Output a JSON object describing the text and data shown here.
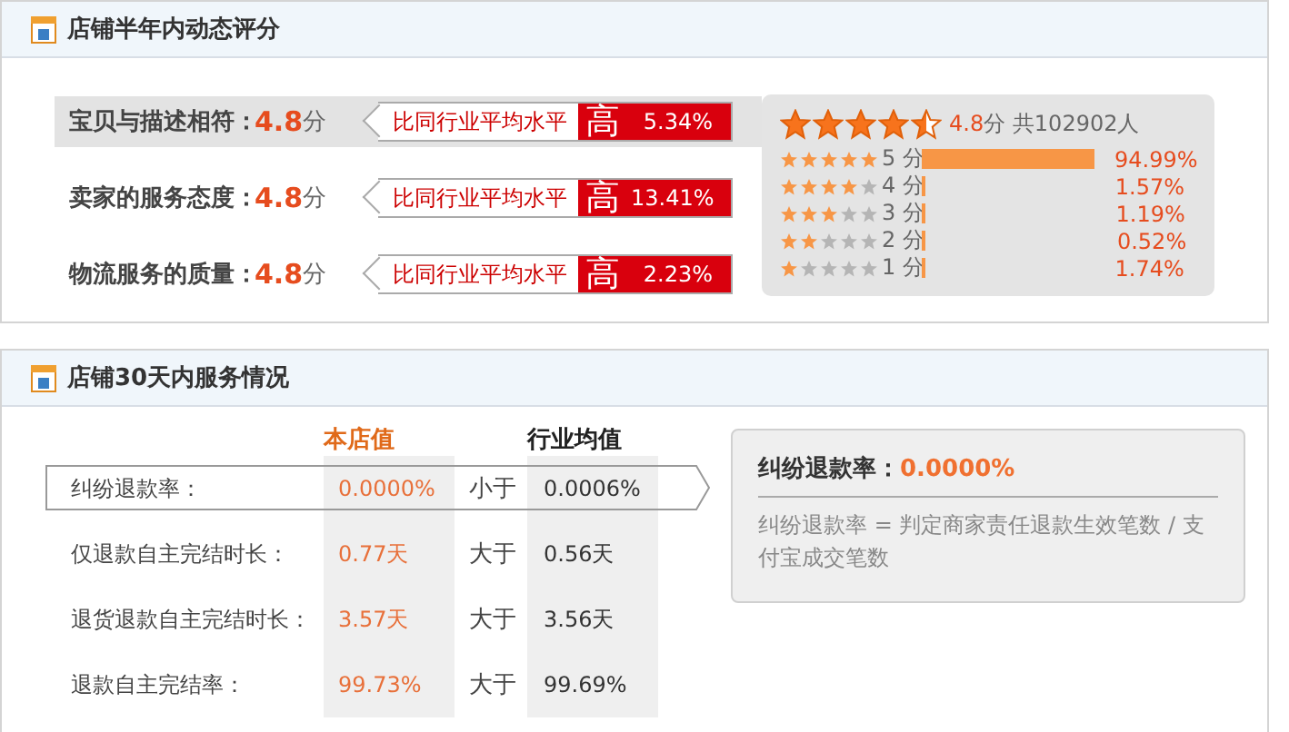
{
  "rating_panel": {
    "title": "店铺半年内动态评分",
    "rows": [
      {
        "label": "宝贝与描述相符：",
        "score": "4.8",
        "unit": "分",
        "selected": true,
        "compare_label": "比同行业平均水平",
        "verdict": "高",
        "diff": "5.34%"
      },
      {
        "label": "卖家的服务态度：",
        "score": "4.8",
        "unit": "分",
        "selected": false,
        "compare_label": "比同行业平均水平",
        "verdict": "高",
        "diff": "13.41%"
      },
      {
        "label": "物流服务的质量：",
        "score": "4.8",
        "unit": "分",
        "selected": false,
        "compare_label": "比同行业平均水平",
        "verdict": "高",
        "diff": "2.23%"
      }
    ],
    "summary": {
      "stars": 4.5,
      "score": "4.8",
      "unit": "分",
      "total": "共102902人",
      "distribution": [
        {
          "stars": 5,
          "label": "5 分",
          "percent": "94.99%"
        },
        {
          "stars": 4,
          "label": "4 分",
          "percent": "1.57%"
        },
        {
          "stars": 3,
          "label": "3 分",
          "percent": "1.19%"
        },
        {
          "stars": 2,
          "label": "2 分",
          "percent": "0.52%"
        },
        {
          "stars": 1,
          "label": "1 分",
          "percent": "1.74%"
        }
      ]
    }
  },
  "service_panel": {
    "title": "店铺30天内服务情况",
    "columns": [
      "本店值",
      "行业均值"
    ],
    "rows": [
      {
        "label": "纠纷退款率：",
        "value": "0.0000%",
        "relation": "小于",
        "industry": "0.0006%",
        "selected": true
      },
      {
        "label": "仅退款自主完结时长：",
        "value": "0.77天",
        "relation": "大于",
        "industry": "0.56天",
        "selected": false
      },
      {
        "label": "退货退款自主完结时长：",
        "value": "3.57天",
        "relation": "大于",
        "industry": "3.56天",
        "selected": false
      },
      {
        "label": "退款自主完结率：",
        "value": "99.73%",
        "relation": "大于",
        "industry": "99.69%",
        "selected": false
      }
    ],
    "detail": {
      "title": "纠纷退款率：",
      "value": "0.0000%",
      "description": "纠纷退款率 = 判定商家责任退款生效笔数 / 支付宝成交笔数"
    }
  }
}
